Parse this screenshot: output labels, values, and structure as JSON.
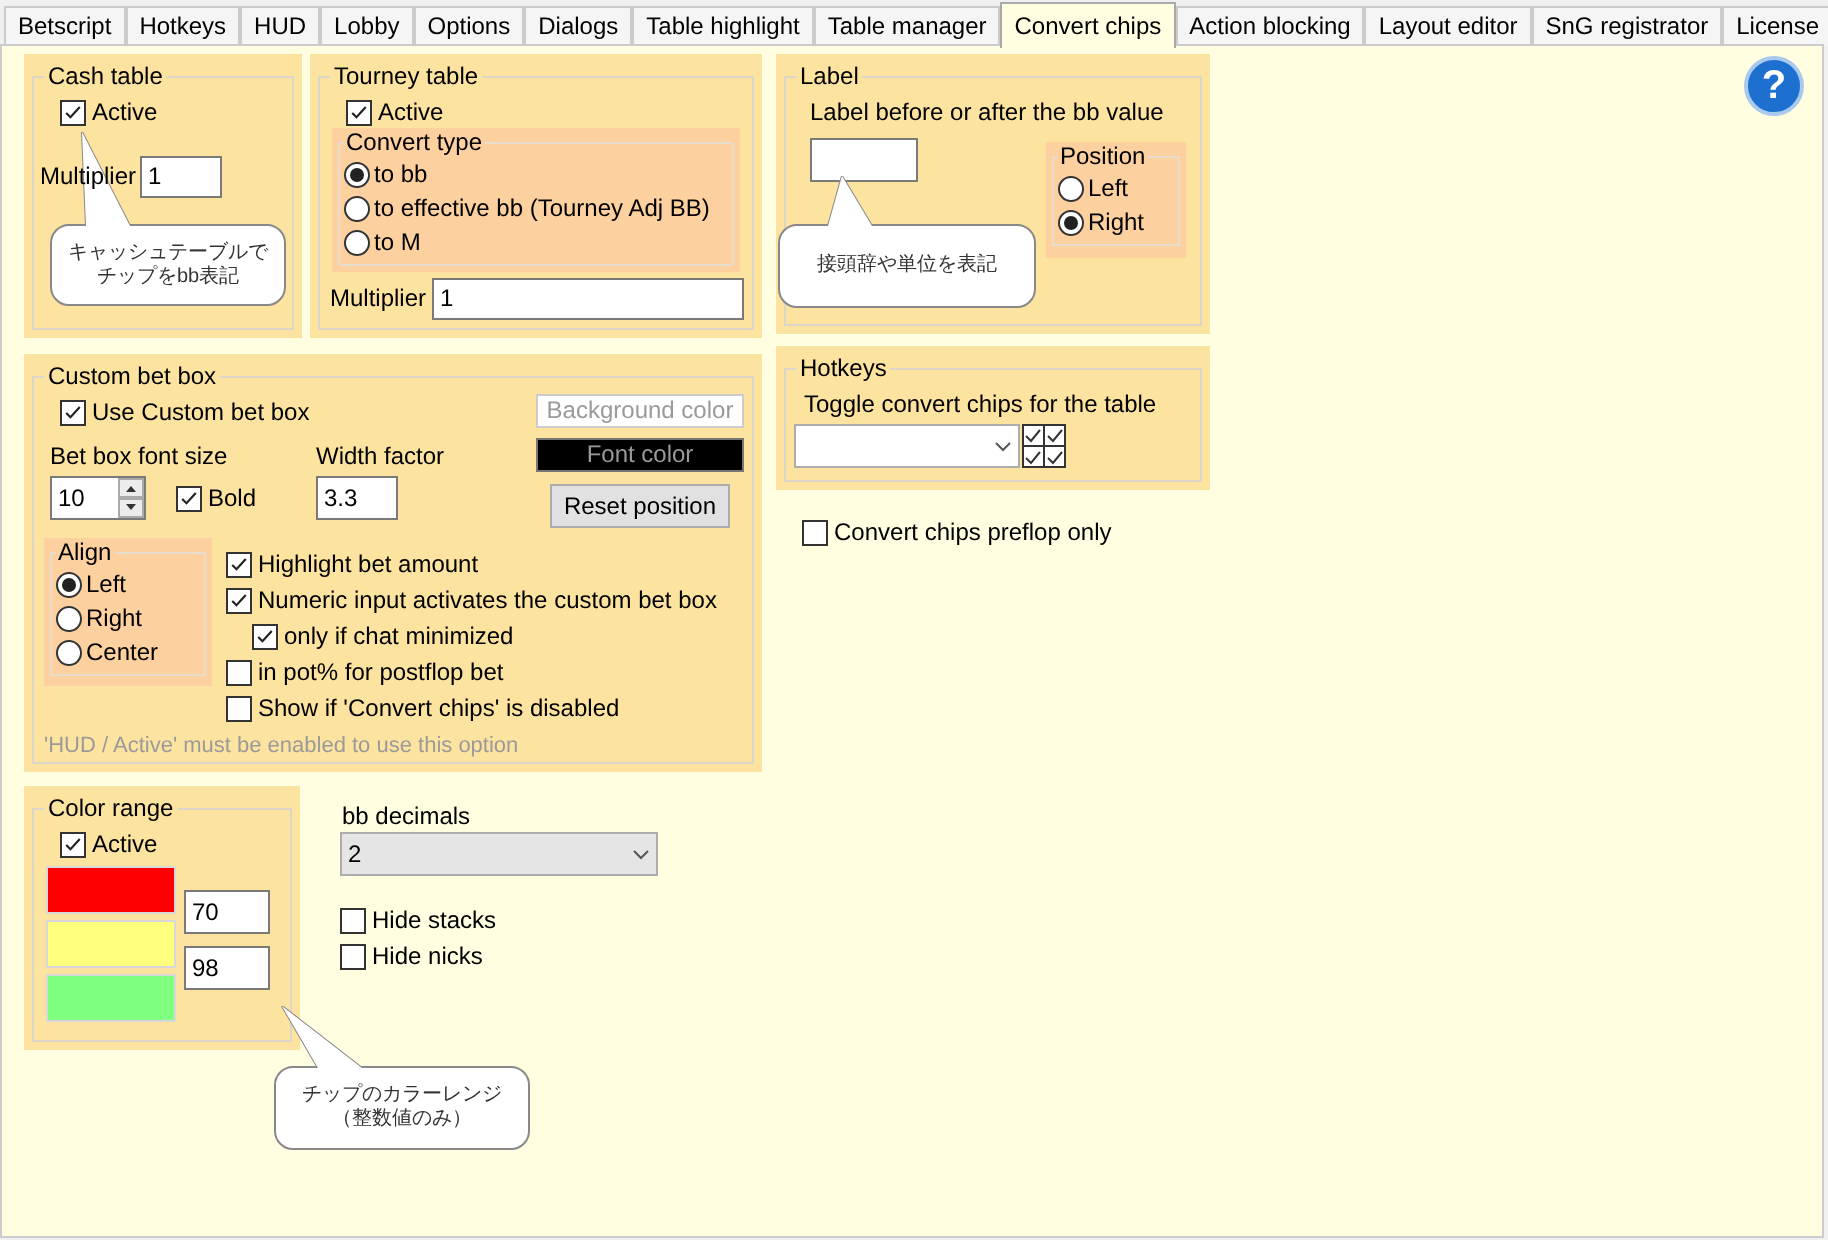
{
  "tabs": [
    {
      "label": "Betscript",
      "selected": false
    },
    {
      "label": "Hotkeys",
      "selected": false
    },
    {
      "label": "HUD",
      "selected": false
    },
    {
      "label": "Lobby",
      "selected": false
    },
    {
      "label": "Options",
      "selected": false
    },
    {
      "label": "Dialogs",
      "selected": false
    },
    {
      "label": "Table highlight",
      "selected": false
    },
    {
      "label": "Table manager",
      "selected": false
    },
    {
      "label": "Convert chips",
      "selected": true
    },
    {
      "label": "Action blocking",
      "selected": false
    },
    {
      "label": "Layout editor",
      "selected": false
    },
    {
      "label": "SnG registrator",
      "selected": false
    },
    {
      "label": "License",
      "selected": false
    }
  ],
  "help": "?",
  "cash_table": {
    "title": "Cash table",
    "active": {
      "label": "Active",
      "checked": true
    },
    "multiplier": {
      "label": "Multiplier",
      "value": "1"
    }
  },
  "tourney_table": {
    "title": "Tourney table",
    "active": {
      "label": "Active",
      "checked": true
    },
    "convert_type": {
      "title": "Convert type",
      "options": [
        {
          "label": "to bb",
          "selected": true
        },
        {
          "label": "to effective bb (Tourney Adj BB)",
          "selected": false
        },
        {
          "label": "to M",
          "selected": false
        }
      ]
    },
    "multiplier": {
      "label": "Multiplier",
      "value": "1"
    }
  },
  "custom_bet_box": {
    "title": "Custom bet box",
    "use": {
      "label": "Use Custom bet box",
      "checked": true
    },
    "font_size": {
      "label": "Bet box font size",
      "value": "10"
    },
    "bold": {
      "label": "Bold",
      "checked": true
    },
    "width_factor": {
      "label": "Width factor",
      "value": "3.3"
    },
    "color_buttons": [
      {
        "label": "Background color",
        "kind": "background"
      },
      {
        "label": "Font color",
        "kind": "font"
      }
    ],
    "reset_button": "Reset position",
    "align": {
      "title": "Align",
      "options": [
        {
          "label": "Left",
          "selected": true
        },
        {
          "label": "Right",
          "selected": false
        },
        {
          "label": "Center",
          "selected": false
        }
      ]
    },
    "options": [
      {
        "label": "Highlight bet amount",
        "checked": true
      },
      {
        "label": "Numeric input activates the custom bet box",
        "checked": true,
        "children": [
          {
            "label": "only if chat minimized",
            "checked": true
          }
        ]
      },
      {
        "label": "in pot% for postflop bet",
        "checked": false
      },
      {
        "label": "Show if 'Convert chips' is disabled",
        "checked": false
      }
    ],
    "note": "'HUD / Active' must be enabled to use this option"
  },
  "color_range": {
    "title": "Color range",
    "active": {
      "label": "Active",
      "checked": true
    },
    "swatches": [
      {
        "color": "#ff0000"
      },
      {
        "color": "#ffff80"
      },
      {
        "color": "#80ff80"
      }
    ],
    "thresholds": [
      "70",
      "98"
    ]
  },
  "bb_decimals": {
    "label": "bb decimals",
    "value": "2"
  },
  "display_options": [
    {
      "label": "Hide stacks",
      "checked": false
    },
    {
      "label": "Hide nicks",
      "checked": false
    }
  ],
  "label_box": {
    "title": "Label",
    "prompt": "Label before or after the bb value",
    "position": {
      "title": "Position",
      "options": [
        {
          "label": "Left",
          "selected": false
        },
        {
          "label": "Right",
          "selected": true
        }
      ]
    }
  },
  "hotkeys": {
    "title": "Hotkeys",
    "label": "Toggle convert chips for the table"
  },
  "preflop_only": {
    "label": "Convert chips preflop only",
    "checked": false
  },
  "callouts": [
    {
      "lines": [
        "キャッシュテーブルで",
        "チップをbb表記"
      ]
    },
    {
      "lines": [
        "接頭辞や単位を表記"
      ]
    },
    {
      "lines": [
        "チップのカラーレンジ",
        "（整数値のみ）"
      ]
    }
  ]
}
